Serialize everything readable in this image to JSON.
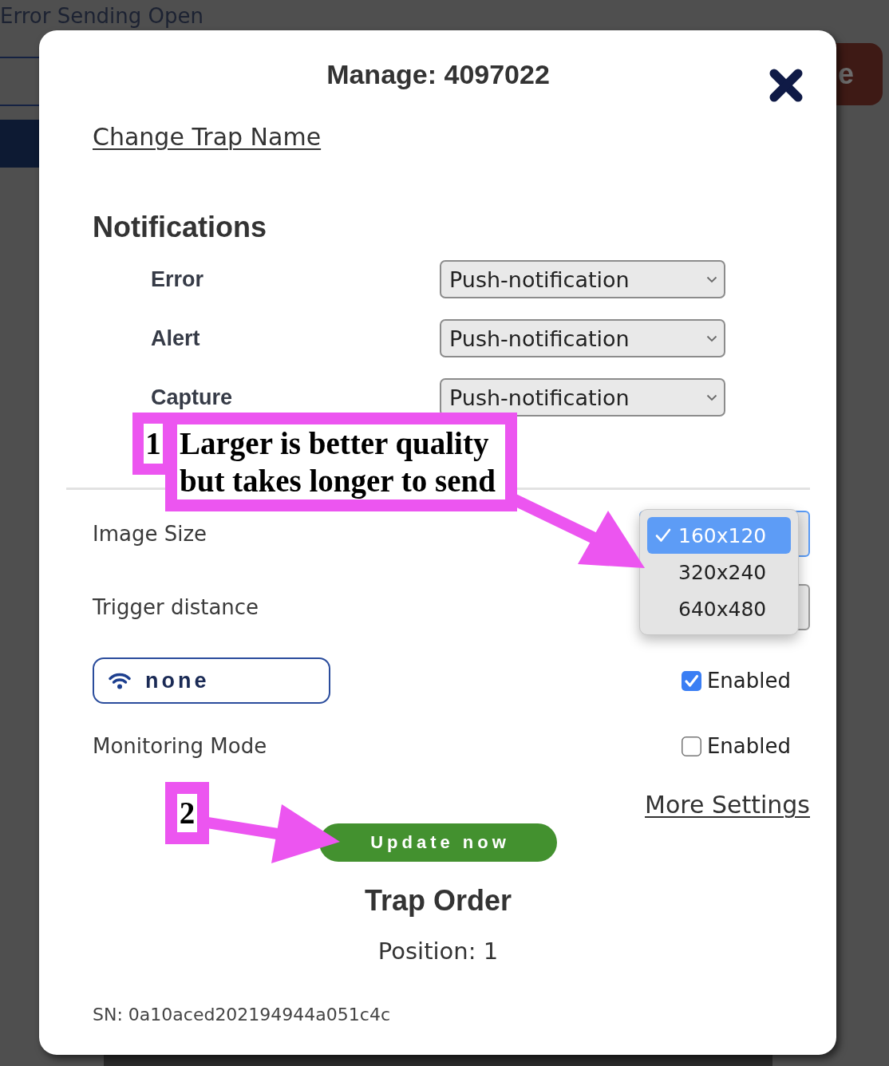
{
  "background": {
    "status_text": "Error Sending Open",
    "button_label": "e"
  },
  "modal": {
    "title": "Manage: 4097022",
    "rename_link": "Change Trap Name"
  },
  "notifications": {
    "heading": "Notifications",
    "rows": [
      {
        "label": "Error",
        "value": "Push-notification"
      },
      {
        "label": "Alert",
        "value": "Push-notification"
      },
      {
        "label": "Capture",
        "value": "Push-notification"
      }
    ]
  },
  "settings": [
    {
      "kind": "select",
      "label": "Image Size",
      "focused": true,
      "dropdown": {
        "open": true,
        "options": [
          {
            "label": "160x120",
            "selected": true
          },
          {
            "label": "320x240",
            "selected": false
          },
          {
            "label": "640x480",
            "selected": false
          }
        ]
      }
    },
    {
      "kind": "select",
      "label": "Trigger distance",
      "focused": false
    },
    {
      "kind": "wifi",
      "button_label": "none",
      "checkbox": {
        "label": "Enabled",
        "checked": true
      }
    },
    {
      "kind": "toggle",
      "label": "Monitoring Mode",
      "checkbox": {
        "label": "Enabled",
        "checked": false
      }
    }
  ],
  "more_settings_link": "More Settings",
  "update_button": "Update now",
  "trap_order": {
    "heading": "Trap Order",
    "position": "Position: 1"
  },
  "serial_number": "SN: 0a10aced202194944a051c4c",
  "annotations": [
    {
      "number": "1",
      "text": "Larger is better quality but takes longer to send"
    },
    {
      "number": "2"
    }
  ]
}
